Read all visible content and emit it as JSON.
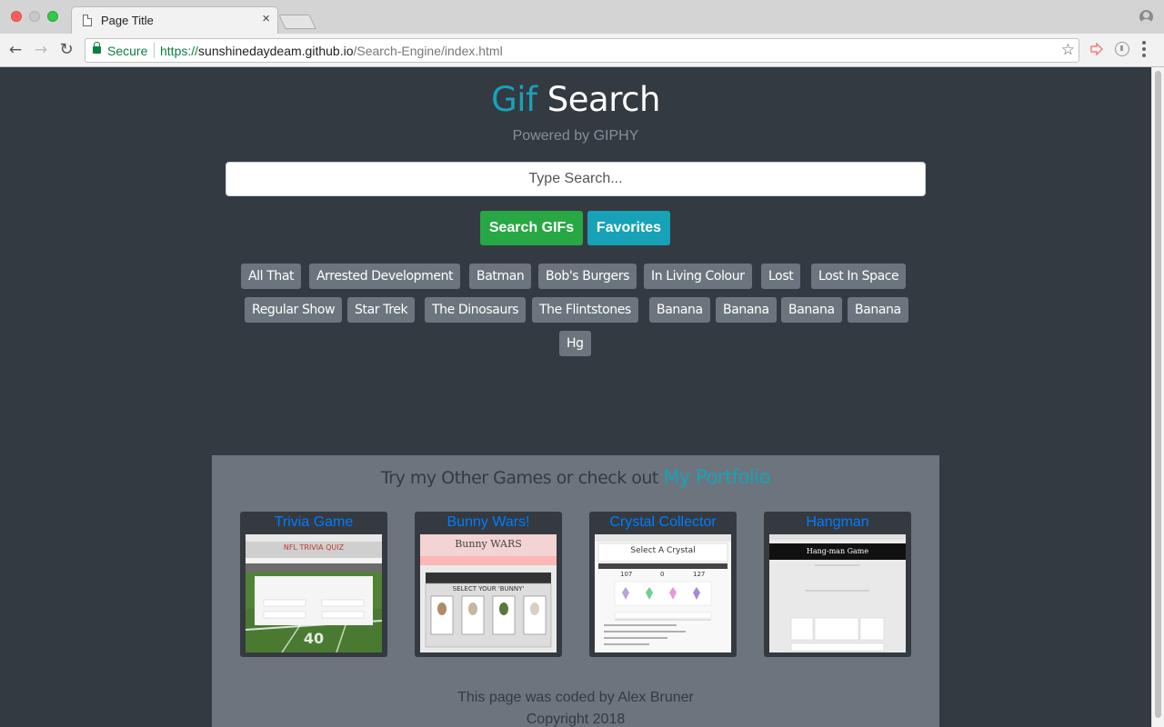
{
  "browser": {
    "tab_title": "Page Title",
    "tab_close": "×",
    "secure_label": "Secure",
    "url_scheme": "https://",
    "url_host": "sunshinedaydeam.github.io",
    "url_path": "/Search-Engine/index.html"
  },
  "header": {
    "title_accent": "Gif",
    "title_rest": " Search",
    "subtitle": "Powered by GIPHY"
  },
  "search": {
    "placeholder": "Type Search...",
    "search_button": "Search GIFs",
    "favorites_button": "Favorites"
  },
  "topics": [
    "All That",
    "Arrested Development",
    "Batman",
    "Bob's Burgers",
    "In Living Colour",
    "Lost",
    "Lost In Space",
    "Regular Show",
    "Star Trek",
    "The Dinosaurs",
    "The Flintstones",
    "Banana",
    "Banana",
    "Banana",
    "Banana",
    "Hg"
  ],
  "footer": {
    "heading_text": "Try my Other Games or check out ",
    "heading_link": "My Portfolio",
    "games": [
      {
        "title": "Trivia Game",
        "thumb_title": "NFL TRIVIA QUIZ"
      },
      {
        "title": "Bunny Wars!",
        "thumb_title": "Bunny WARS",
        "thumb_subtitle": "SELECT YOUR 'BUNNY'"
      },
      {
        "title": "Crystal Collector",
        "thumb_title": "Select A Crystal",
        "thumb_numbers": [
          "107",
          "0",
          "127"
        ]
      },
      {
        "title": "Hangman",
        "thumb_title": "Hang-man Game"
      }
    ],
    "credit_line1": "This page was coded by Alex Bruner",
    "credit_line2": "Copyright 2018"
  },
  "colors": {
    "page_bg": "#343a42",
    "accent_teal": "#17a2b8",
    "success_green": "#28a745",
    "topic_gray": "#6c757d",
    "link_blue": "#007bff"
  }
}
